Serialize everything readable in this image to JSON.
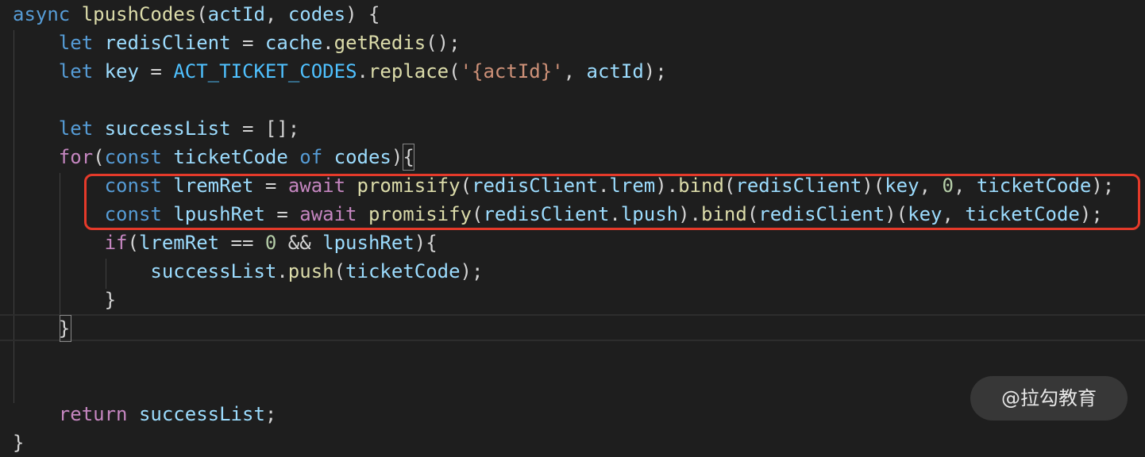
{
  "code": {
    "lines": [
      [
        {
          "t": "async",
          "c": "kw"
        },
        {
          "t": " ",
          "c": "pun"
        },
        {
          "t": "lpushCodes",
          "c": "fn"
        },
        {
          "t": "(",
          "c": "pun"
        },
        {
          "t": "actId",
          "c": "var"
        },
        {
          "t": ", ",
          "c": "pun"
        },
        {
          "t": "codes",
          "c": "var"
        },
        {
          "t": ") {",
          "c": "pun"
        }
      ],
      [
        {
          "t": "    ",
          "c": "pun"
        },
        {
          "t": "let",
          "c": "kw"
        },
        {
          "t": " ",
          "c": "pun"
        },
        {
          "t": "redisClient",
          "c": "var"
        },
        {
          "t": " = ",
          "c": "pun"
        },
        {
          "t": "cache",
          "c": "var"
        },
        {
          "t": ".",
          "c": "pun"
        },
        {
          "t": "getRedis",
          "c": "fn"
        },
        {
          "t": "();",
          "c": "pun"
        }
      ],
      [
        {
          "t": "    ",
          "c": "pun"
        },
        {
          "t": "let",
          "c": "kw"
        },
        {
          "t": " ",
          "c": "pun"
        },
        {
          "t": "key",
          "c": "var"
        },
        {
          "t": " = ",
          "c": "pun"
        },
        {
          "t": "ACT_TICKET_CODES",
          "c": "const"
        },
        {
          "t": ".",
          "c": "pun"
        },
        {
          "t": "replace",
          "c": "fn"
        },
        {
          "t": "(",
          "c": "pun"
        },
        {
          "t": "'{actId}'",
          "c": "str"
        },
        {
          "t": ", ",
          "c": "pun"
        },
        {
          "t": "actId",
          "c": "var"
        },
        {
          "t": ");",
          "c": "pun"
        }
      ],
      [],
      [
        {
          "t": "    ",
          "c": "pun"
        },
        {
          "t": "let",
          "c": "kw"
        },
        {
          "t": " ",
          "c": "pun"
        },
        {
          "t": "successList",
          "c": "var"
        },
        {
          "t": " = [];",
          "c": "pun"
        }
      ],
      [
        {
          "t": "    ",
          "c": "pun"
        },
        {
          "t": "for",
          "c": "kw2"
        },
        {
          "t": "(",
          "c": "pun"
        },
        {
          "t": "const",
          "c": "kw"
        },
        {
          "t": " ",
          "c": "pun"
        },
        {
          "t": "ticketCode",
          "c": "var"
        },
        {
          "t": " ",
          "c": "pun"
        },
        {
          "t": "of",
          "c": "kw"
        },
        {
          "t": " ",
          "c": "pun"
        },
        {
          "t": "codes",
          "c": "var"
        },
        {
          "t": "){",
          "c": "pun"
        }
      ],
      [
        {
          "t": "        ",
          "c": "pun"
        },
        {
          "t": "const",
          "c": "kw"
        },
        {
          "t": " ",
          "c": "pun"
        },
        {
          "t": "lremRet",
          "c": "var"
        },
        {
          "t": " = ",
          "c": "pun"
        },
        {
          "t": "await",
          "c": "kw2"
        },
        {
          "t": " ",
          "c": "pun"
        },
        {
          "t": "promisify",
          "c": "fn"
        },
        {
          "t": "(",
          "c": "pun"
        },
        {
          "t": "redisClient",
          "c": "var"
        },
        {
          "t": ".",
          "c": "pun"
        },
        {
          "t": "lrem",
          "c": "var"
        },
        {
          "t": ").",
          "c": "pun"
        },
        {
          "t": "bind",
          "c": "fn"
        },
        {
          "t": "(",
          "c": "pun"
        },
        {
          "t": "redisClient",
          "c": "var"
        },
        {
          "t": ")(",
          "c": "pun"
        },
        {
          "t": "key",
          "c": "var"
        },
        {
          "t": ", ",
          "c": "pun"
        },
        {
          "t": "0",
          "c": "num"
        },
        {
          "t": ", ",
          "c": "pun"
        },
        {
          "t": "ticketCode",
          "c": "var"
        },
        {
          "t": ");",
          "c": "pun"
        }
      ],
      [
        {
          "t": "        ",
          "c": "pun"
        },
        {
          "t": "const",
          "c": "kw"
        },
        {
          "t": " ",
          "c": "pun"
        },
        {
          "t": "lpushRet",
          "c": "var"
        },
        {
          "t": " = ",
          "c": "pun"
        },
        {
          "t": "await",
          "c": "kw2"
        },
        {
          "t": " ",
          "c": "pun"
        },
        {
          "t": "promisify",
          "c": "fn"
        },
        {
          "t": "(",
          "c": "pun"
        },
        {
          "t": "redisClient",
          "c": "var"
        },
        {
          "t": ".",
          "c": "pun"
        },
        {
          "t": "lpush",
          "c": "var"
        },
        {
          "t": ").",
          "c": "pun"
        },
        {
          "t": "bind",
          "c": "fn"
        },
        {
          "t": "(",
          "c": "pun"
        },
        {
          "t": "redisClient",
          "c": "var"
        },
        {
          "t": ")(",
          "c": "pun"
        },
        {
          "t": "key",
          "c": "var"
        },
        {
          "t": ", ",
          "c": "pun"
        },
        {
          "t": "ticketCode",
          "c": "var"
        },
        {
          "t": ");",
          "c": "pun"
        }
      ],
      [
        {
          "t": "        ",
          "c": "pun"
        },
        {
          "t": "if",
          "c": "kw2"
        },
        {
          "t": "(",
          "c": "pun"
        },
        {
          "t": "lremRet",
          "c": "var"
        },
        {
          "t": " == ",
          "c": "pun"
        },
        {
          "t": "0",
          "c": "num"
        },
        {
          "t": " && ",
          "c": "pun"
        },
        {
          "t": "lpushRet",
          "c": "var"
        },
        {
          "t": "){",
          "c": "pun"
        }
      ],
      [
        {
          "t": "            ",
          "c": "pun"
        },
        {
          "t": "successList",
          "c": "var"
        },
        {
          "t": ".",
          "c": "pun"
        },
        {
          "t": "push",
          "c": "fn"
        },
        {
          "t": "(",
          "c": "pun"
        },
        {
          "t": "ticketCode",
          "c": "var"
        },
        {
          "t": ");",
          "c": "pun"
        }
      ],
      [
        {
          "t": "        }",
          "c": "pun"
        }
      ],
      [
        {
          "t": "    }",
          "c": "pun"
        }
      ],
      [],
      [],
      [
        {
          "t": "    ",
          "c": "pun"
        },
        {
          "t": "return",
          "c": "kw2"
        },
        {
          "t": " ",
          "c": "pun"
        },
        {
          "t": "successList",
          "c": "var"
        },
        {
          "t": ";",
          "c": "pun"
        }
      ],
      [
        {
          "t": "}",
          "c": "pun"
        }
      ]
    ]
  },
  "watermark": {
    "text": "@拉勾教育"
  }
}
